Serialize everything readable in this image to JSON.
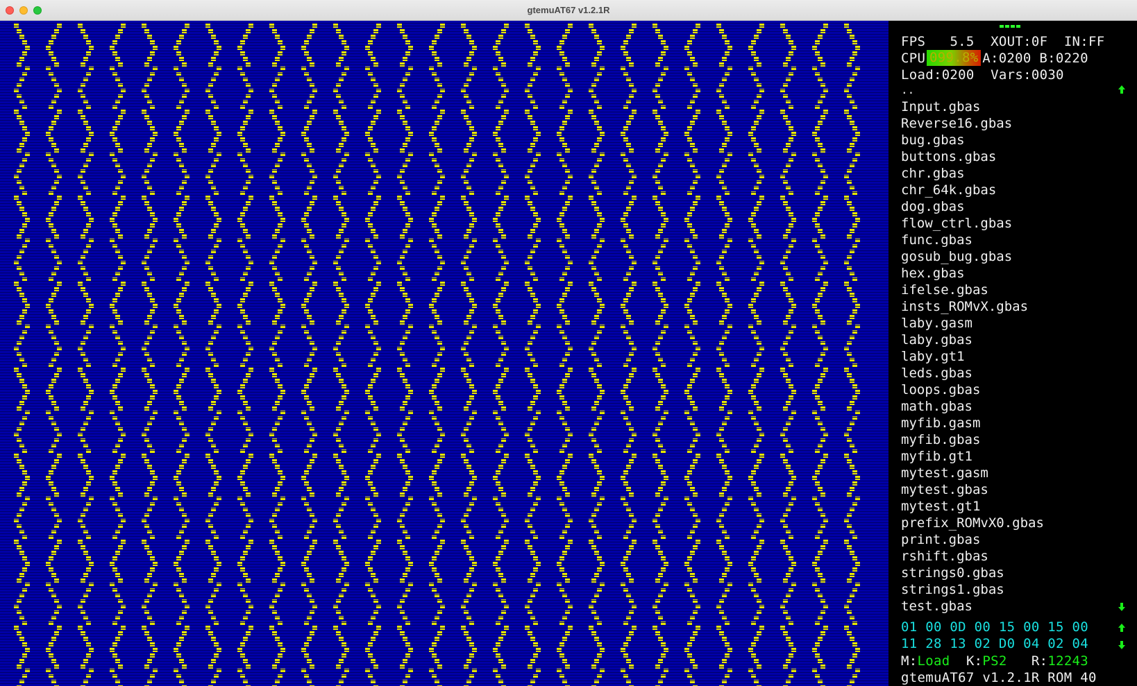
{
  "window": {
    "title": "gtemuAT67 v1.2.1R"
  },
  "colors": {
    "screen_bg": "#0000a8",
    "pattern": "#e8e800",
    "scanline": "#00006a",
    "hex_text": "#19e0e0",
    "status_value": "#19ee19"
  },
  "stats": {
    "fps_label": "FPS",
    "fps_value": "5.5",
    "xout": "XOUT:0F",
    "in": "IN:FF",
    "cpu_label": "CPU",
    "cpu_value": "099.8%",
    "a": "A:0200",
    "b": "B:0220",
    "load": "Load:0200",
    "vars": "Vars:0030"
  },
  "file_browser": {
    "parent": "..",
    "files": [
      "Input.gbas",
      "Reverse16.gbas",
      "bug.gbas",
      "buttons.gbas",
      "chr.gbas",
      "chr_64k.gbas",
      "dog.gbas",
      "flow_ctrl.gbas",
      "func.gbas",
      "gosub_bug.gbas",
      "hex.gbas",
      "ifelse.gbas",
      "insts_ROMvX.gbas",
      "laby.gasm",
      "laby.gbas",
      "laby.gt1",
      "leds.gbas",
      "loops.gbas",
      "math.gbas",
      "myfib.gasm",
      "myfib.gbas",
      "myfib.gt1",
      "mytest.gasm",
      "mytest.gbas",
      "mytest.gt1",
      "prefix_ROMvX0.gbas",
      "print.gbas",
      "rshift.gbas",
      "strings0.gbas",
      "strings1.gbas",
      "test.gbas"
    ]
  },
  "memory": {
    "row1": "01 00 0D 00 15 00 15 00",
    "row2": "11 28 13 02 D0 04 02 04"
  },
  "status": {
    "mode_label": "M:",
    "mode_value": "Load",
    "keyboard_label": "K:",
    "keyboard_value": "PS2",
    "rom_label": "R:",
    "rom_value": "12243",
    "footer": "gtemuAT67 v1.2.1R ROM 40"
  },
  "icons": {
    "scroll_up": "arrow-up-icon",
    "scroll_down": "arrow-down-icon"
  }
}
